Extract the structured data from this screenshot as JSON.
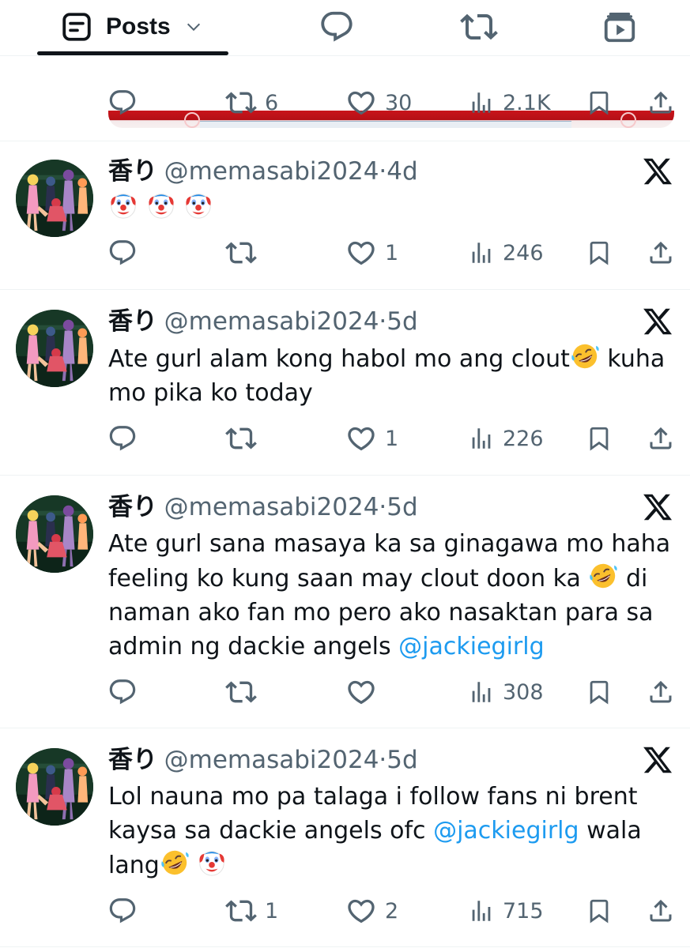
{
  "tabs": {
    "posts_label": "Posts"
  },
  "previous_post": {
    "reposts": "6",
    "likes": "30",
    "views": "2.1K"
  },
  "tweets": [
    {
      "name": "香り",
      "handle": "@memasabi2024",
      "sep": "·",
      "time": "4d",
      "text_segments": [
        "",
        "",
        ""
      ],
      "emojis": [
        "clown-face",
        "clown-face",
        "clown-face"
      ],
      "replies": "",
      "reposts": "",
      "likes": "1",
      "views": "246"
    },
    {
      "name": "香り",
      "handle": "@memasabi2024",
      "sep": "·",
      "time": "5d",
      "text_1": "Ate gurl alam kong habol mo ang clout",
      "text_2": " kuha mo pika ko today",
      "emojis": [
        "rolling-on-floor-laughing"
      ],
      "replies": "",
      "reposts": "",
      "likes": "1",
      "views": "226"
    },
    {
      "name": "香り",
      "handle": "@memasabi2024",
      "sep": "·",
      "time": "5d",
      "text_1": "Ate gurl sana masaya ka sa ginagawa mo haha feeling ko kung saan may clout doon ka ",
      "text_2": " di naman ako fan mo pero ako nasaktan para sa admin ng dackie angels ",
      "mention": "@jackiegirlg",
      "emojis": [
        "rolling-on-floor-laughing"
      ],
      "replies": "",
      "reposts": "",
      "likes": "",
      "views": "308"
    },
    {
      "name": "香り",
      "handle": "@memasabi2024",
      "sep": "·",
      "time": "5d",
      "text_1": "Lol nauna mo pa talaga i follow fans ni brent kaysa sa dackie angels ofc ",
      "mention": "@jackiegirlg",
      "text_2": " wala lang",
      "emojis": [
        "rolling-on-floor-laughing",
        "clown-face"
      ],
      "replies": "",
      "reposts": "1",
      "likes": "2",
      "views": "715"
    }
  ],
  "colors": {
    "text": "#0f1419",
    "secondary": "#536471",
    "link": "#1d9bf0",
    "divider": "#eff3f4"
  }
}
